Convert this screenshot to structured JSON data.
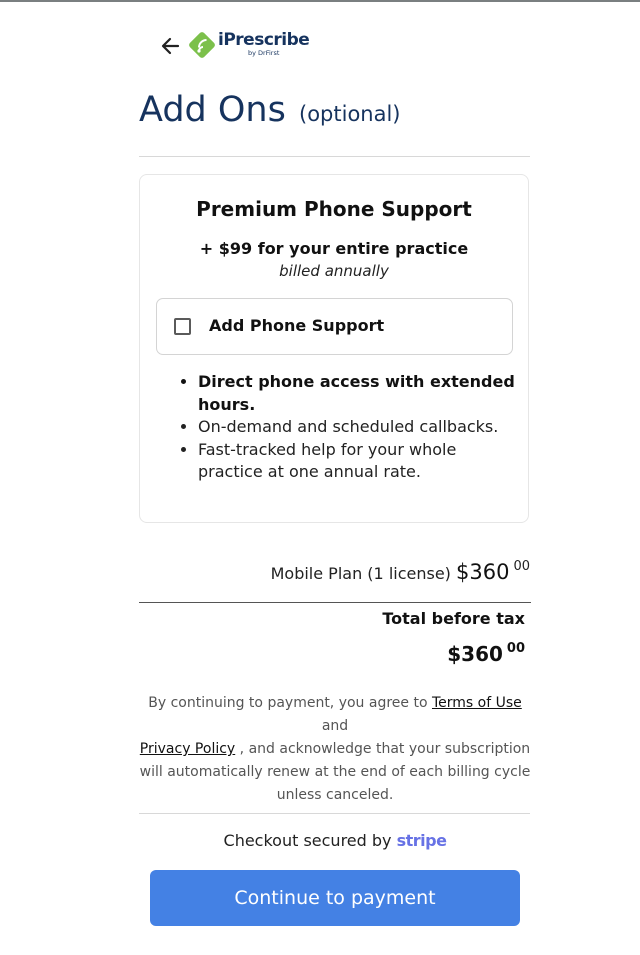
{
  "header": {
    "back_icon": "arrow-left-icon",
    "brand_name": "iPrescribe",
    "brand_by": "by DrFirst",
    "brand_color": "#16335e",
    "logo_green": "#7cc04b"
  },
  "page": {
    "title": "Add Ons",
    "title_suffix": "(optional)"
  },
  "addon": {
    "title": "Premium Phone Support",
    "price": "+ $99 for your entire practice",
    "billing": "billed annually",
    "option_label": "Add Phone Support",
    "option_checked": false,
    "features": [
      "Direct phone access with extended hours.",
      "On-demand and scheduled callbacks.",
      "Fast-tracked help for your whole practice at one annual rate."
    ]
  },
  "summary": {
    "plan_label": "Mobile Plan (1 license)",
    "plan_amount": "$360",
    "plan_cents": "00",
    "total_label": "Total before tax",
    "total_amount": "$360",
    "total_cents": "00"
  },
  "legal": {
    "prefix": "By continuing to payment, you agree to",
    "terms_link": "Terms of Use",
    "and": "and",
    "privacy_link": "Privacy Policy",
    "suffix": ", and acknowledge that your subscription will automatically renew at the end of each billing cycle unless canceled."
  },
  "checkout": {
    "secured_text": "Checkout secured by",
    "provider": "stripe",
    "provider_color": "#6772e5",
    "cta_label": "Continue to payment",
    "cta_color": "#4481e4"
  }
}
